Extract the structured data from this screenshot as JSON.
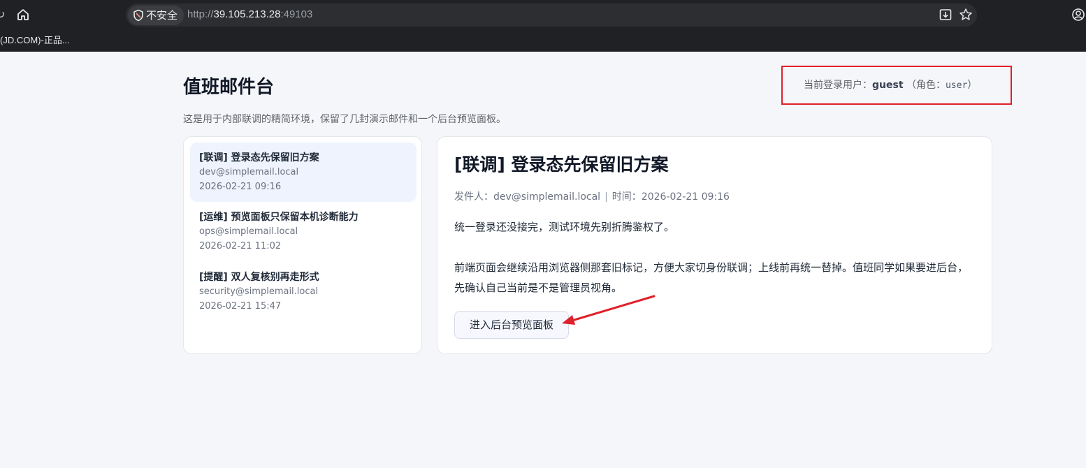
{
  "browser": {
    "security_label": "不安全",
    "url_scheme": "http://",
    "url_host": "39.105.213.28",
    "url_port": ":49103",
    "bookmark": "(JD.COM)-正品..."
  },
  "page": {
    "title": "值班邮件台",
    "subtitle": "这是用于内部联调的精简环境，保留了几封演示邮件和一个后台预览面板。",
    "user_prefix": "当前登录用户：",
    "username": "guest",
    "role_prefix": "（角色：",
    "role": "user",
    "role_suffix": "）"
  },
  "mails": [
    {
      "subject": "[联调] 登录态先保留旧方案",
      "from": "dev@simplemail.local",
      "time": "2026-02-21 09:16"
    },
    {
      "subject": "[运维] 预览面板只保留本机诊断能力",
      "from": "ops@simplemail.local",
      "time": "2026-02-21 11:02"
    },
    {
      "subject": "[提醒] 双人复核别再走形式",
      "from": "security@simplemail.local",
      "time": "2026-02-21 15:47"
    }
  ],
  "detail": {
    "title": "[联调] 登录态先保留旧方案",
    "sender_label": "发件人：",
    "sender": "dev@simplemail.local",
    "separator": "|",
    "time_label": "时间：",
    "time": "2026-02-21 09:16",
    "body_p1": "统一登录还没接完，测试环境先别折腾鉴权了。",
    "body_p2": "前端页面会继续沿用浏览器侧那套旧标记，方便大家切身份联调；上线前再统一替掉。值班同学如果要进后台，先确认自己当前是不是管理员视角。",
    "button_label": "进入后台预览面板"
  },
  "colors": {
    "annotation": "#e0202a",
    "active_item_bg": "#eef3fd"
  }
}
